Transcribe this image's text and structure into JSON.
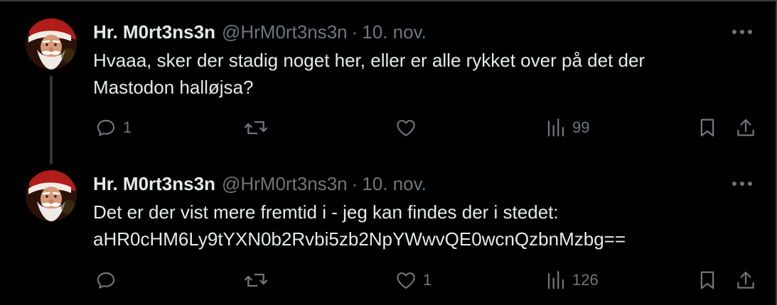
{
  "colors": {
    "background": "#000000",
    "primary_text": "#e7e9ea",
    "secondary_text": "#71767b",
    "thread_line": "#333639"
  },
  "icons": {
    "reply": "speech-bubble-icon",
    "retweet": "retweet-arrows-icon",
    "like": "heart-icon",
    "views": "bar-chart-icon",
    "bookmark": "bookmark-icon",
    "share": "share-upload-icon",
    "more": "three-dots-icon"
  },
  "tweets": [
    {
      "display_name": "Hr. M0rt3ns3n",
      "handle": "@HrM0rt3ns3n",
      "separator": "·",
      "date": "10. nov.",
      "text_lines": [
        "Hvaaa, sker der stadig noget her, eller er alle rykket over på det der",
        "Mastodon halløjsa?"
      ],
      "replies": "1",
      "retweets": "",
      "likes": "",
      "views": "99"
    },
    {
      "display_name": "Hr. M0rt3ns3n",
      "handle": "@HrM0rt3ns3n",
      "separator": "·",
      "date": "10. nov.",
      "text_lines": [
        "Det er der vist mere fremtid i - jeg kan findes der i stedet:",
        "aHR0cHM6Ly9tYXN0b2Rvbi5zb2NpYWwvQE0wcnQzbnMzbg=="
      ],
      "replies": "",
      "retweets": "",
      "likes": "1",
      "views": "126"
    }
  ]
}
